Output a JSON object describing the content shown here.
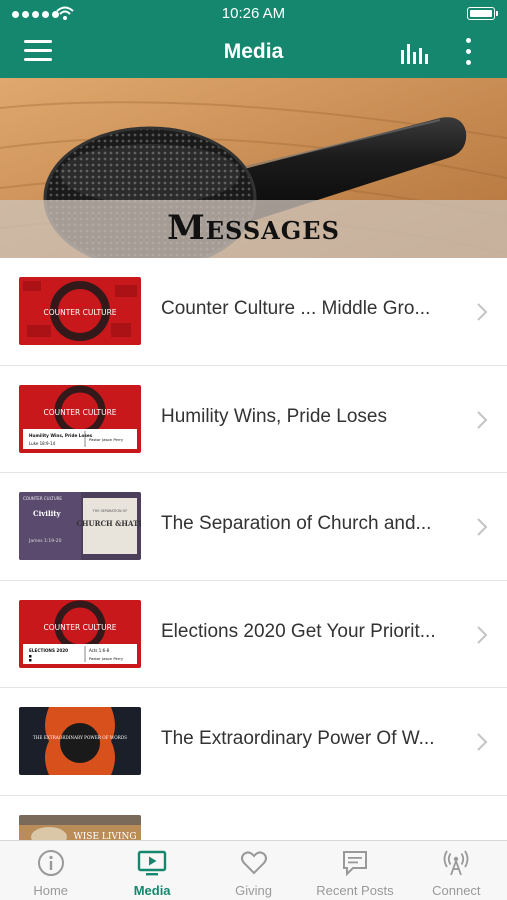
{
  "status_bar": {
    "time": "10:26 AM"
  },
  "header": {
    "title": "Media"
  },
  "banner": {
    "title": "Messages"
  },
  "messages": [
    {
      "title": "Counter Culture ... Middle Gro...",
      "thumb": {
        "series": "COUNTER CULTURE"
      }
    },
    {
      "title": "Humility Wins, Pride Loses",
      "thumb": {
        "series": "COUNTER CULTURE",
        "sub": "Humility Wins, Pride Loses",
        "ref": "Luke 18:9-14",
        "speaker": "Pastor Jason Perry"
      }
    },
    {
      "title": "The Separation of Church and...",
      "thumb": {
        "series": "COUNTER CULTURE",
        "left": "Civility",
        "ref": "James 1:19-20",
        "right_top": "THE SEPARATION OF",
        "right_main": "CHURCH &HATE"
      }
    },
    {
      "title": "Elections 2020 Get Your Priorit...",
      "thumb": {
        "series": "COUNTER CULTURE",
        "sub": "ELECTIONS 2020",
        "ref": "Acts 1:6-8",
        "speaker": "Pastor Jason Perry"
      }
    },
    {
      "title": "The Extraordinary Power Of W...",
      "thumb": {
        "text": "THE EXTRAORDINARY POWER OF WORDS"
      }
    },
    {
      "title": "",
      "thumb": {
        "text": "WISE LIVING"
      }
    }
  ],
  "tabs": [
    {
      "label": "Home",
      "icon": "info-icon",
      "active": false
    },
    {
      "label": "Media",
      "icon": "media-play-icon",
      "active": true
    },
    {
      "label": "Giving",
      "icon": "heart-icon",
      "active": false
    },
    {
      "label": "Recent Posts",
      "icon": "chat-icon",
      "active": false
    },
    {
      "label": "Connect",
      "icon": "broadcast-icon",
      "active": false
    }
  ],
  "colors": {
    "brand": "#15876e",
    "inactive": "#999999",
    "thumb_red": "#c8181c"
  }
}
